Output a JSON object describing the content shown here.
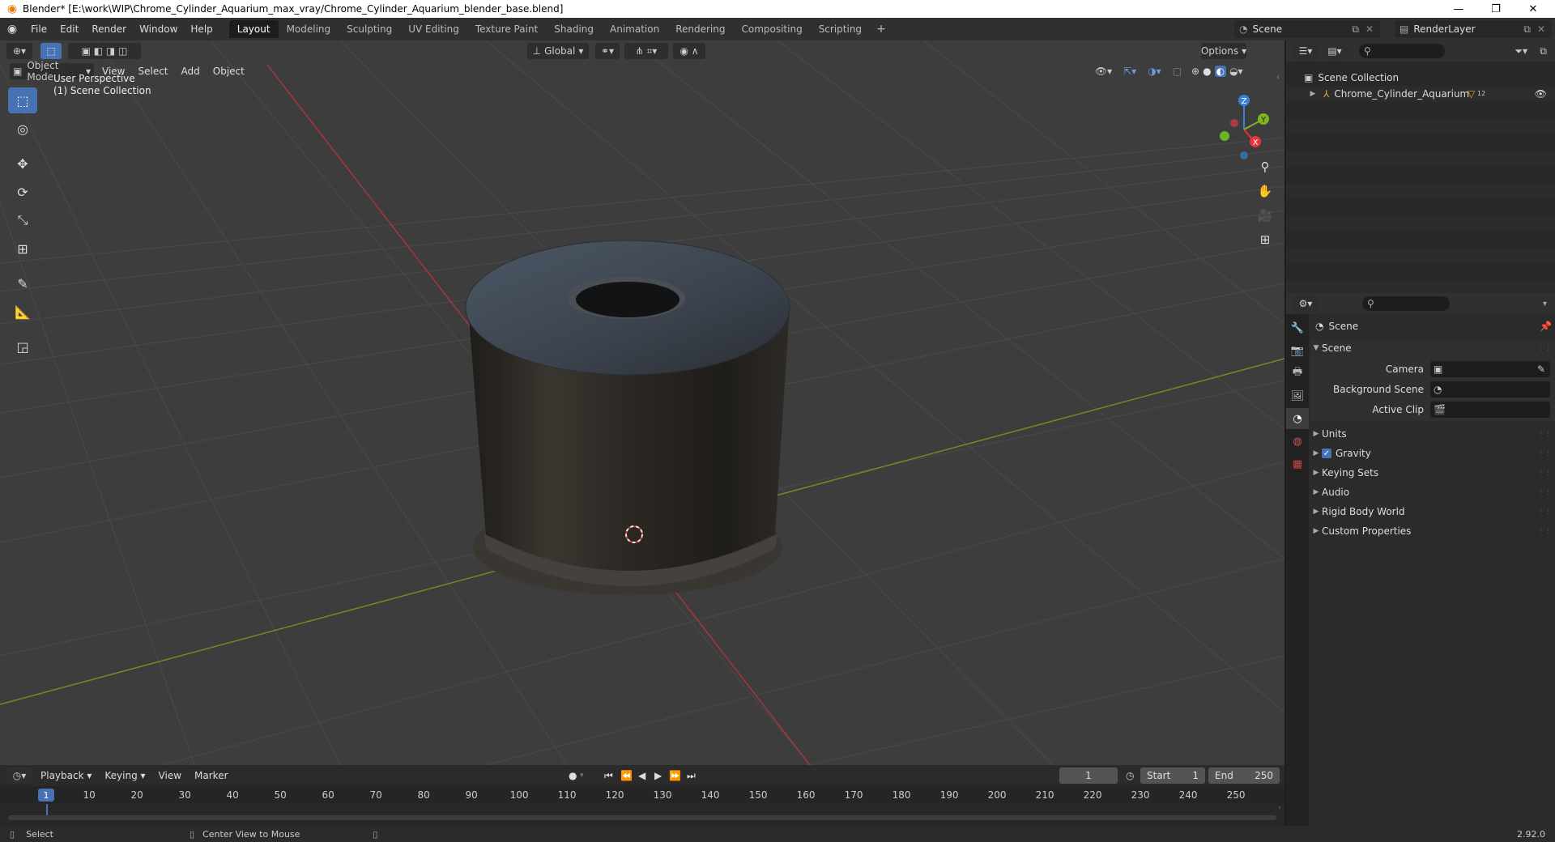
{
  "window": {
    "title": "Blender* [E:\\work\\WIP\\Chrome_Cylinder_Aquarium_max_vray/Chrome_Cylinder_Aquarium_blender_base.blend]",
    "minimize": "—",
    "maximize": "❐",
    "close": "✕"
  },
  "menubar": {
    "items": [
      "File",
      "Edit",
      "Render",
      "Window",
      "Help"
    ],
    "workspaces": [
      "Layout",
      "Modeling",
      "Sculpting",
      "UV Editing",
      "Texture Paint",
      "Shading",
      "Animation",
      "Rendering",
      "Compositing",
      "Scripting"
    ],
    "active_workspace": "Layout",
    "add_workspace": "+",
    "scene_name": "Scene",
    "render_layer": "RenderLayer"
  },
  "viewport": {
    "transform_orientation": "Global",
    "options_label": "Options",
    "mode": "Object Mode",
    "menus": [
      "View",
      "Select",
      "Add",
      "Object"
    ],
    "overlay_line1": "User Perspective",
    "overlay_line2": "(1) Scene Collection",
    "axes": {
      "x": "X",
      "y": "Y",
      "z": "Z"
    }
  },
  "timeline": {
    "menus": [
      "Playback",
      "Keying",
      "View",
      "Marker"
    ],
    "current_frame": "1",
    "start_label": "Start",
    "start_value": "1",
    "end_label": "End",
    "end_value": "250",
    "ticks": [
      "1",
      "10",
      "20",
      "30",
      "40",
      "50",
      "60",
      "70",
      "80",
      "90",
      "100",
      "110",
      "120",
      "130",
      "140",
      "150",
      "160",
      "170",
      "180",
      "190",
      "200",
      "210",
      "220",
      "230",
      "240",
      "250"
    ]
  },
  "outliner": {
    "root": "Scene Collection",
    "object": "Chrome_Cylinder_Aquarium",
    "object_badge": "12"
  },
  "properties": {
    "context": "Scene",
    "panel": "Scene",
    "camera_label": "Camera",
    "background_scene_label": "Background Scene",
    "active_clip_label": "Active Clip",
    "subpanels": [
      "Units",
      "Gravity",
      "Keying Sets",
      "Audio",
      "Rigid Body World",
      "Custom Properties"
    ]
  },
  "statusbar": {
    "select": "Select",
    "center_view": "Center View to Mouse",
    "version": "2.92.0"
  },
  "colors": {
    "accent": "#4772b3",
    "x_axis": "#e5353b",
    "y_axis": "#7fb51f",
    "z_axis": "#3d7fd8",
    "viewport_bg": "#3d3d3d"
  }
}
